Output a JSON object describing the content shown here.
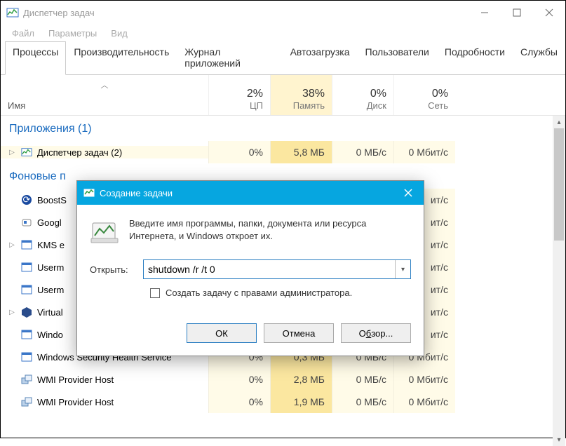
{
  "window": {
    "title": "Диспетчер задач",
    "menu": {
      "file": "Файл",
      "options": "Параметры",
      "view": "Вид"
    },
    "tabs": {
      "processes": "Процессы",
      "performance": "Производительность",
      "app_history": "Журнал приложений",
      "startup": "Автозагрузка",
      "users": "Пользователи",
      "details": "Подробности",
      "services": "Службы"
    }
  },
  "columns": {
    "name": "Имя",
    "cpu_pct": "2%",
    "cpu_lbl": "ЦП",
    "mem_pct": "38%",
    "mem_lbl": "Память",
    "disk_pct": "0%",
    "disk_lbl": "Диск",
    "net_pct": "0%",
    "net_lbl": "Сеть"
  },
  "groups": {
    "apps": "Приложения (1)",
    "background": "Фоновые п"
  },
  "rows": [
    {
      "name": "Диспетчер задач (2)",
      "cpu": "0%",
      "mem": "5,8 МБ",
      "disk": "0 МБ/с",
      "net": "0 Мбит/с",
      "expandable": true
    },
    {
      "name": "BoostS",
      "cpu": "",
      "mem": "",
      "disk": "",
      "net": "ит/с",
      "expandable": false
    },
    {
      "name": "Googl",
      "cpu": "",
      "mem": "",
      "disk": "",
      "net": "ит/с",
      "expandable": false
    },
    {
      "name": "KMS e",
      "cpu": "",
      "mem": "",
      "disk": "",
      "net": "ит/с",
      "expandable": true
    },
    {
      "name": "Userm",
      "cpu": "",
      "mem": "",
      "disk": "",
      "net": "ит/с",
      "expandable": false
    },
    {
      "name": "Userm",
      "cpu": "",
      "mem": "",
      "disk": "",
      "net": "ит/с",
      "expandable": false
    },
    {
      "name": "Virtual",
      "cpu": "",
      "mem": "",
      "disk": "",
      "net": "ит/с",
      "expandable": true
    },
    {
      "name": "Windo",
      "cpu": "",
      "mem": "",
      "disk": "",
      "net": "ит/с",
      "expandable": false
    },
    {
      "name": "Windows Security Health Service",
      "cpu": "0%",
      "mem": "0,3 МБ",
      "disk": "0 МБ/с",
      "net": "0 Мбит/с",
      "expandable": false
    },
    {
      "name": "WMI Provider Host",
      "cpu": "0%",
      "mem": "2,8 МБ",
      "disk": "0 МБ/с",
      "net": "0 Мбит/с",
      "expandable": false
    },
    {
      "name": "WMI Provider Host",
      "cpu": "0%",
      "mem": "1,9 МБ",
      "disk": "0 МБ/с",
      "net": "0 Мбит/с",
      "expandable": false
    }
  ],
  "dialog": {
    "title": "Создание задачи",
    "description": "Введите имя программы, папки, документа или ресурса Интернета, и Windows откроет их.",
    "open_label": "Открыть:",
    "input_value": "shutdown /r /t 0",
    "admin_checkbox": "Создать задачу с правами администратора.",
    "ok": "ОК",
    "cancel": "Отмена",
    "browse_prefix": "О",
    "browse_underline": "б",
    "browse_suffix": "зор..."
  }
}
